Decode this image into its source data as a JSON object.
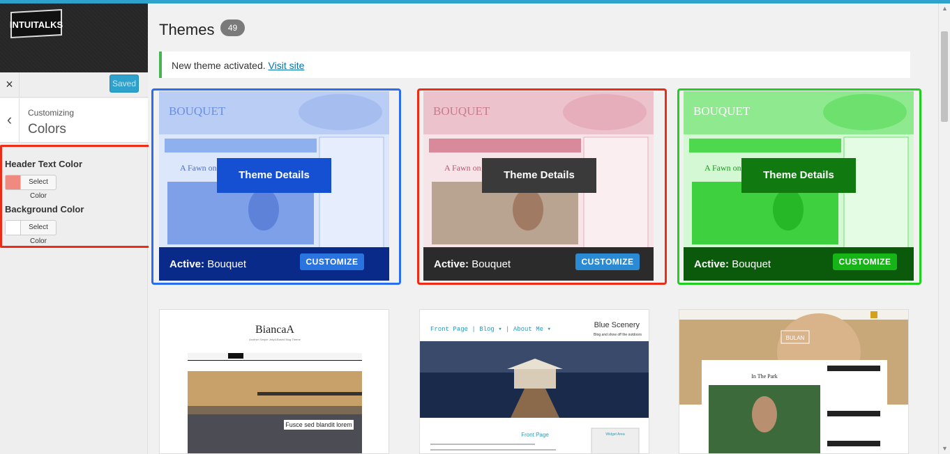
{
  "sidebar": {
    "logo_text": "INTUITALKS",
    "close_label": "×",
    "saved_label": "Saved",
    "customizing_label": "Customizing",
    "section_title": "Colors",
    "controls": [
      {
        "label": "Header Text Color",
        "button": "Select Color",
        "swatch": "#f08a80"
      },
      {
        "label": "Background Color",
        "button": "Select Color",
        "swatch": "#ffffff"
      }
    ]
  },
  "main": {
    "title": "Themes",
    "count": "49",
    "notice_text": "New theme activated.",
    "notice_link": "Visit site",
    "cards": [
      {
        "theme_name": "BOUQUET",
        "post_title": "A Fawn on a River",
        "details_label": "Theme Details",
        "active_prefix": "Active:",
        "active_name": "Bouquet",
        "customize_label": "CUSTOMIZE",
        "tint": "#3c78e6",
        "details_bg": "#1550d2",
        "bar_bg": "#0a2a8a",
        "btn_bg": "#2a74e0",
        "outline": "#2a6df0"
      },
      {
        "theme_name": "BOUQUET",
        "post_title": "A Fawn on a River",
        "details_label": "Theme Details",
        "active_prefix": "Active:",
        "active_name": "Bouquet",
        "customize_label": "CUSTOMIZE",
        "tint": "#e87a8e",
        "details_bg": "#3a3a3a",
        "bar_bg": "#2b2b2b",
        "btn_bg": "#2a8ad4",
        "outline": "#ee2b15"
      },
      {
        "theme_name": "BOUQUET",
        "post_title": "A Fawn on a River",
        "details_label": "Theme Details",
        "active_prefix": "Active:",
        "active_name": "Bouquet",
        "customize_label": "CUSTOMIZE",
        "tint": "#33e033",
        "details_bg": "#107a10",
        "bar_bg": "#0b5a0b",
        "btn_bg": "#16b416",
        "outline": "#1fd01f"
      }
    ],
    "row2": [
      {
        "title": "BiancaA",
        "subtitle": "Another Simple Jekyll-Based Blog Theme",
        "caption": "Fusce sed blandit lorem"
      },
      {
        "nav": "Front Page | Blog ▾ | About Me ▾",
        "title": "Blue Scenery",
        "subtitle": "Blog and show off the outdoors",
        "page": "Front Page",
        "widget": "Widget Area"
      },
      {
        "title": "BULAN",
        "post": "In The Park"
      }
    ]
  }
}
